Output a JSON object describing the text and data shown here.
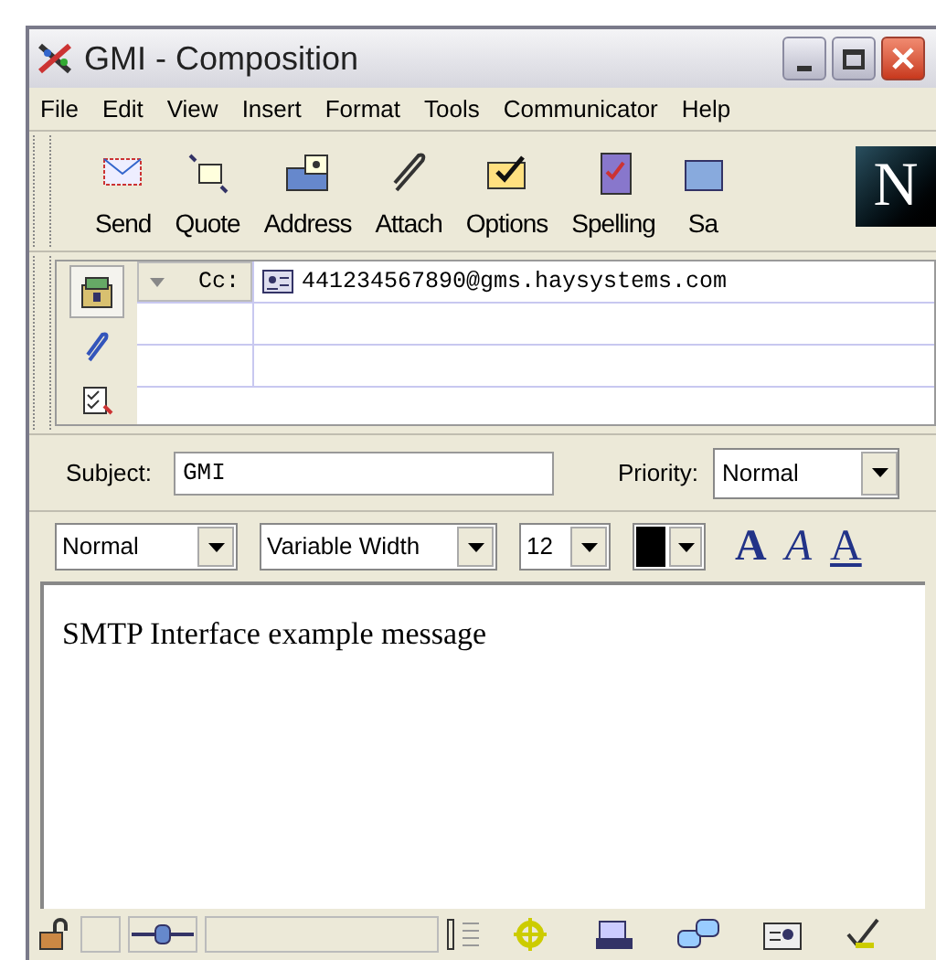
{
  "window": {
    "title": "GMI - Composition"
  },
  "menu": [
    "File",
    "Edit",
    "View",
    "Insert",
    "Format",
    "Tools",
    "Communicator",
    "Help"
  ],
  "toolbar": [
    {
      "label": "Send",
      "kind": "send"
    },
    {
      "label": "Quote",
      "kind": "quote"
    },
    {
      "label": "Address",
      "kind": "address"
    },
    {
      "label": "Attach",
      "kind": "attach"
    },
    {
      "label": "Options",
      "kind": "options"
    },
    {
      "label": "Spelling",
      "kind": "spelling"
    },
    {
      "label": "Sa",
      "kind": "save"
    }
  ],
  "logo": "N",
  "recipients": [
    {
      "type": "Cc:",
      "address": "441234567890@gms.haysystems.com"
    }
  ],
  "subject": {
    "label": "Subject:",
    "value": "GMI"
  },
  "priority": {
    "label": "Priority:",
    "value": "Normal"
  },
  "format": {
    "paragraph": "Normal",
    "font": "Variable Width",
    "size": "12",
    "color": "#000000",
    "styles": [
      {
        "glyph": "A",
        "kind": "bold"
      },
      {
        "glyph": "A",
        "kind": "italic"
      },
      {
        "glyph": "A",
        "kind": "underline"
      }
    ]
  },
  "body": "SMTP Interface example message"
}
